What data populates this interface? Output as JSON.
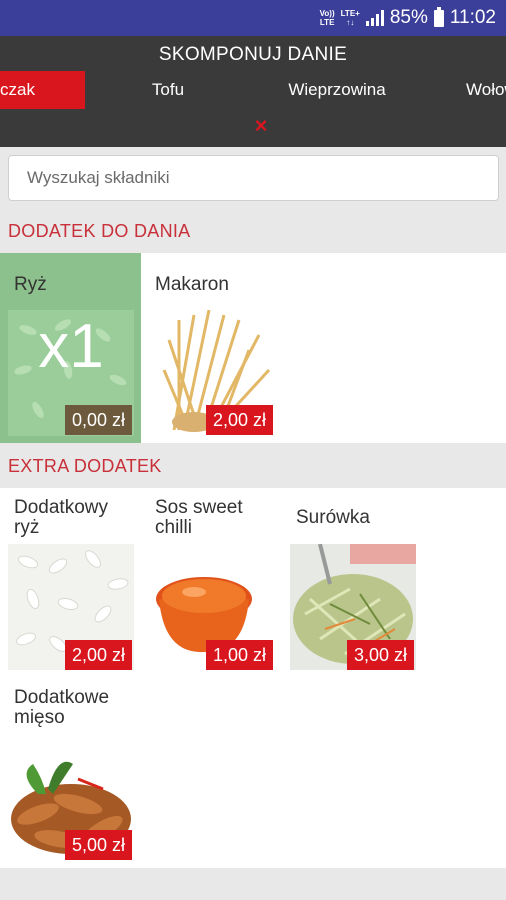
{
  "status_bar": {
    "carrier_top": "Vo)) ",
    "carrier_bottom": "LTE",
    "net_top": "LTE+",
    "battery": "85%",
    "time": "11:02"
  },
  "header": {
    "title": "SKOMPONUJ DANIE",
    "tabs": [
      {
        "label": "czak",
        "active": true
      },
      {
        "label": "Tofu",
        "active": false
      },
      {
        "label": "Wieprzowina",
        "active": false
      },
      {
        "label": "Wołowina",
        "active": false
      }
    ],
    "close_icon": "×"
  },
  "search": {
    "placeholder": "Wyszukaj składniki",
    "value": ""
  },
  "sections": {
    "side": {
      "label": "DODATEK DO DANIA",
      "items": [
        {
          "name": "Ryż",
          "price": "0,00 zł",
          "selected": true,
          "quantity": "x1"
        },
        {
          "name": "Makaron",
          "price": "2,00 zł",
          "selected": false
        }
      ]
    },
    "extra": {
      "label": "EXTRA DODATEK",
      "items": [
        {
          "name_line1": "Dodatkowy",
          "name_line2": "ryż",
          "price": "2,00 zł"
        },
        {
          "name_line1": "Sos sweet",
          "name_line2": "chilli",
          "price": "1,00 zł"
        },
        {
          "name_line1": "Surówka",
          "name_line2": "",
          "price": "3,00 zł"
        },
        {
          "name_line1": "Dodatkowe",
          "name_line2": "mięso",
          "price": "5,00 zł"
        }
      ]
    }
  },
  "colors": {
    "accent": "#d9161e",
    "header_bg": "#3a3a3a",
    "status_bg": "#3b3f9a",
    "selected_bg": "#8cc08c",
    "section_label": "#c8303a"
  }
}
